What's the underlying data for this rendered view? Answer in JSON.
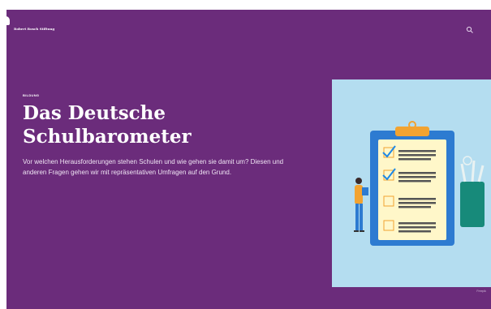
{
  "header": {
    "logo_text": "Robert Bosch Stiftung",
    "search_icon": "search-icon"
  },
  "hero": {
    "eyebrow": "BILDUNG",
    "title": "Das Deutsche Schulbarometer",
    "lead": "Vor welchen Herausforderungen stehen Schulen und wie gehen sie damit um? Diesen und anderen Fragen gehen wir mit repräsentativen Umfragen auf den Grund.",
    "image_credit": "Freepik"
  },
  "illustration": {
    "subject": "checklist-clipboard-with-person",
    "colors": {
      "background": "#b4ddf0",
      "board": "#2d7bd1",
      "clip": "#f2a331",
      "paper": "#fff7c9",
      "check": "#1e88e5",
      "cup": "#178a7a"
    }
  },
  "colors": {
    "brand_purple": "#6b2c7b",
    "text": "#ffffff"
  }
}
